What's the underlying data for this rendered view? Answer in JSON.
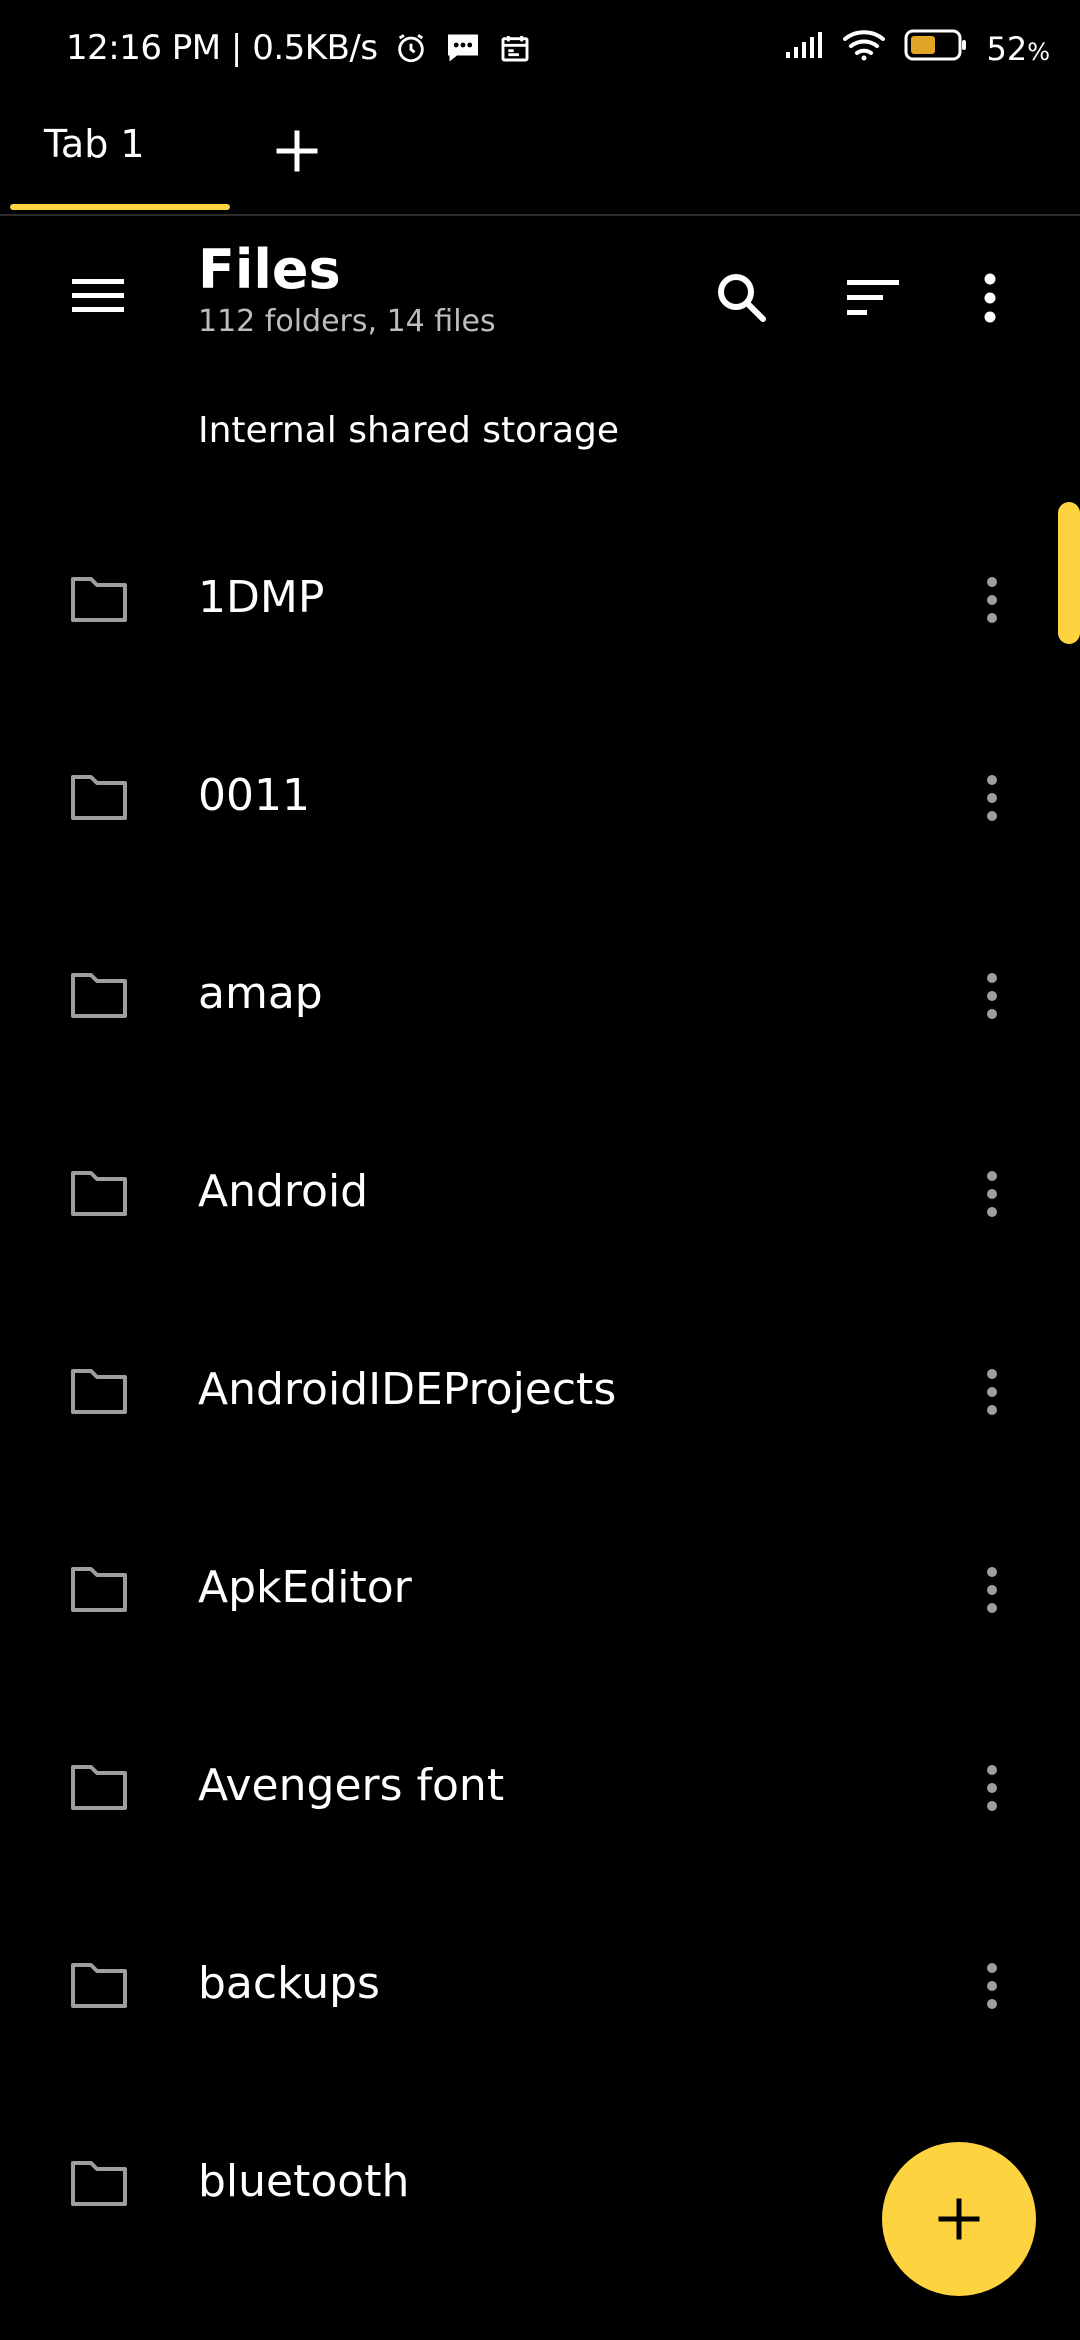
{
  "status_bar": {
    "time_speed": "12:16 PM | 0.5KB/s",
    "battery_percent": "52",
    "battery_unit": "%"
  },
  "tabs": [
    {
      "label": "Tab 1",
      "active": true
    }
  ],
  "header": {
    "title": "Files",
    "subtitle": "112 folders, 14 files"
  },
  "storage": {
    "label": "Internal shared storage"
  },
  "files": [
    {
      "name": "1DMP"
    },
    {
      "name": "0011"
    },
    {
      "name": "amap"
    },
    {
      "name": "Android"
    },
    {
      "name": "AndroidIDEProjects"
    },
    {
      "name": "ApkEditor"
    },
    {
      "name": "Avengers font"
    },
    {
      "name": "backups"
    },
    {
      "name": "bluetooth"
    }
  ],
  "colors": {
    "accent": "#fdd33f",
    "background": "#000000",
    "icon_gray": "#9e9e9e"
  },
  "icons": {
    "menu": "hamburger-icon",
    "search": "search-icon",
    "sort": "sort-icon",
    "more": "more-vertical-icon",
    "folder": "folder-icon",
    "add": "plus-icon"
  }
}
